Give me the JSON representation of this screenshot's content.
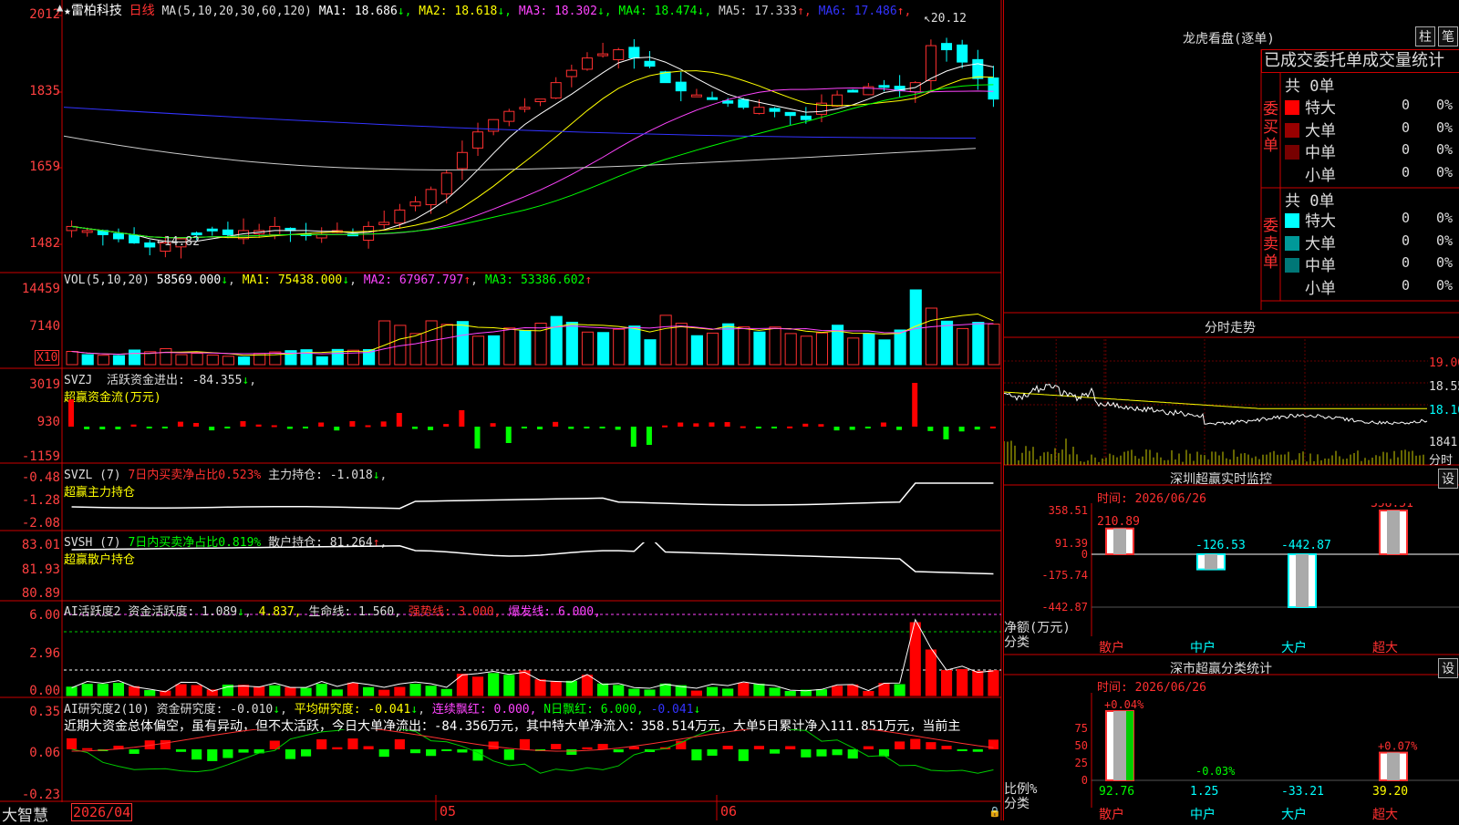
{
  "header": {
    "star": "★",
    "name": "雷柏科技",
    "period": "日线",
    "ma_desc": "MA(5,10,20,30,60,120)",
    "ma": [
      {
        "label": "MA1:",
        "val": "18.686",
        "arrow": "↓",
        "color": "#ffffff"
      },
      {
        "label": "MA2:",
        "val": "18.618",
        "arrow": "↓",
        "color": "#ffff00"
      },
      {
        "label": "MA3:",
        "val": "18.302",
        "arrow": "↓",
        "color": "#ff44ff"
      },
      {
        "label": "MA4:",
        "val": "18.474",
        "arrow": "↓",
        "color": "#00ff00"
      },
      {
        "label": "MA5:",
        "val": "17.333",
        "arrow": "↑",
        "color": "#cccccc"
      },
      {
        "label": "MA6:",
        "val": "17.486",
        "arrow": "↑",
        "color": "#3333ff"
      }
    ]
  },
  "price_axis": [
    "2012",
    "1835",
    "1659",
    "1482"
  ],
  "price_marks": {
    "high": "20.12",
    "low": "14.82"
  },
  "vol": {
    "title": "VOL(5,10,20)",
    "v": "58569.000",
    "ma1": "MA1: 75438.000",
    "ma2": "MA2: 67967.797",
    "ma3": "MA3: 53386.602",
    "axis": [
      "14459",
      "7140"
    ],
    "unit": "X10"
  },
  "svzj": {
    "title": "SVZJ",
    "desc": "活跃资金进出: -84.355",
    "arrow": "↓",
    "sub": "超赢资金流(万元)",
    "axis": [
      "3019",
      "930",
      "-1159"
    ]
  },
  "svzl": {
    "title": "SVZL (7)",
    "desc1": "7日内买卖净占比0.523%",
    "desc2": "主力持仓: -1.018",
    "sub": "超赢主力持仓",
    "axis": [
      "-0.48",
      "-1.28",
      "-2.08"
    ]
  },
  "svsh": {
    "title": "SVSH (7)",
    "desc1": "7日内买卖净占比0.819%",
    "desc2": "散户持仓: 81.264",
    "sub": "超赢散户持仓",
    "axis": [
      "83.01",
      "81.93",
      "80.89"
    ]
  },
  "ai1": {
    "title": "AI活跃度2",
    "desc": "资金活跃度: 1.089",
    "v2": "4.837,",
    "v3": "生命线: 1.560,",
    "v4": "强势线: 3.000,",
    "v5": "爆发线: 6.000,",
    "axis": [
      "6.00",
      "2.96",
      "0.00"
    ]
  },
  "ai2": {
    "title": "AI研究度2(10)",
    "desc": "资金研究度: -0.010",
    "v2": "平均研究度: -0.041",
    "v3": "连续飘红: 0.000,",
    "v4": "N日飘红: 6.000,",
    "v5": "-0.041",
    "axis": [
      "0.35",
      "0.06",
      "-0.23"
    ],
    "comment": "近期大资金总体偏空，虽有异动，但不太活跃，今日大单净流出：-84.356万元，其中特大单净流入：358.514万元，大单5日累计净入111.851万元，当前主"
  },
  "bottom": {
    "brand": "大智慧",
    "date": "2026/04",
    "m5": "05",
    "m6": "06"
  },
  "lhb": {
    "title": "龙虎看盘(逐单)",
    "btn1": "柱",
    "btn2": "笔",
    "tabs": "已成交委托单成交量统计",
    "buy_label": "委买单",
    "sell_label": "委卖单",
    "buy_total": "共 0单",
    "sell_total": "共 0单",
    "buy": [
      {
        "name": "特大",
        "n": "0",
        "p": "0%",
        "c": "#ff0000"
      },
      {
        "name": "大单",
        "n": "0",
        "p": "0%",
        "c": "#990000"
      },
      {
        "name": "中单",
        "n": "0",
        "p": "0%",
        "c": "#770000"
      },
      {
        "name": "小单",
        "n": "0",
        "p": "0%",
        "c": "#000000"
      }
    ],
    "sell": [
      {
        "name": "特大",
        "n": "0",
        "p": "0%",
        "c": "#00ffff"
      },
      {
        "name": "大单",
        "n": "0",
        "p": "0%",
        "c": "#009999"
      },
      {
        "name": "中单",
        "n": "0",
        "p": "0%",
        "c": "#007777"
      },
      {
        "name": "小单",
        "n": "0",
        "p": "0%",
        "c": "#000000"
      }
    ]
  },
  "fs": {
    "title": "分时走势",
    "axis": [
      "19.00",
      "18.55",
      "18.10",
      "1841"
    ],
    "unit": "分时"
  },
  "szjk": {
    "title": "深圳超赢实时监控",
    "btn": "设",
    "time": "时间: 2026/06/26",
    "yaxis": [
      "358.51",
      "91.39",
      "0",
      "-175.74",
      "-442.87"
    ],
    "ylabel": "净额(万元)",
    "xlabel": "分类",
    "cats": [
      "散户",
      "中户",
      "大户",
      "超大"
    ],
    "values": [
      "210.89",
      "-126.53",
      "-442.87",
      "358.51"
    ]
  },
  "sscat": {
    "title": "深市超赢分类统计",
    "btn": "设",
    "time": "时间: 2026/06/26",
    "yaxis": [
      "75",
      "50",
      "25",
      "0"
    ],
    "ylabel": "比例%",
    "xlabel": "分类",
    "cats": [
      "散户",
      "中户",
      "大户",
      "超大"
    ],
    "top": [
      "+0.04%",
      "-0.03%",
      "",
      "+0.07%"
    ],
    "vals": [
      "92.76",
      "1.25",
      "-33.21",
      "39.20"
    ]
  }
}
